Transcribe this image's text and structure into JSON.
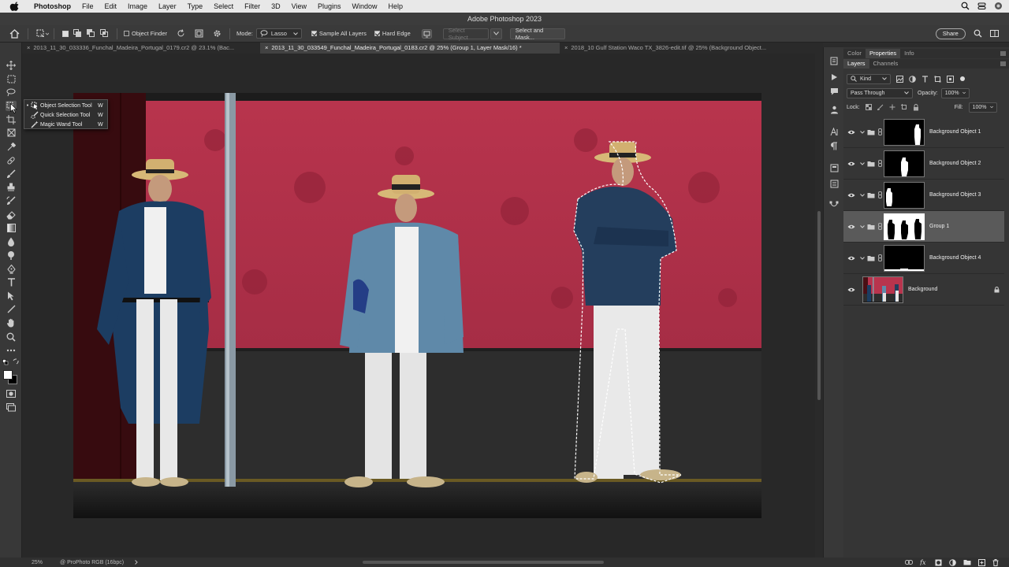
{
  "menubar": {
    "app_name": "Photoshop",
    "items": [
      "File",
      "Edit",
      "Image",
      "Layer",
      "Type",
      "Select",
      "Filter",
      "3D",
      "View",
      "Plugins",
      "Window",
      "Help"
    ]
  },
  "window": {
    "title": "Adobe Photoshop 2023"
  },
  "options_bar": {
    "object_finder_label": "Object Finder",
    "mode_label": "Mode:",
    "mode_value": "Lasso",
    "sample_all_layers_label": "Sample All Layers",
    "sample_all_layers_checked": true,
    "hard_edge_label": "Hard Edge",
    "hard_edge_checked": true,
    "select_subject_label": "Select Subject",
    "select_and_mask_label": "Select and Mask...",
    "share_label": "Share"
  },
  "tabs": [
    {
      "close": "×",
      "label": "2013_11_30_033336_Funchal_Madeira_Portugal_0179.cr2 @ 23.1% (Bac...",
      "active": false
    },
    {
      "close": "×",
      "label": "2013_11_30_033549_Funchal_Madeira_Portugal_0183.cr2 @ 25% (Group 1, Layer Mask/16) *",
      "active": true
    },
    {
      "close": "×",
      "label": "2018_10 Gulf Station Waco TX_3826-edit.tif @ 25% (Background Object...",
      "active": false
    }
  ],
  "tool_flyout": {
    "items": [
      {
        "label": "Object Selection Tool",
        "shortcut": "W",
        "active": true
      },
      {
        "label": "Quick Selection Tool",
        "shortcut": "W",
        "active": false
      },
      {
        "label": "Magic Wand Tool",
        "shortcut": "W",
        "active": false
      }
    ]
  },
  "panels": {
    "top_tabs": [
      "Color",
      "Properties",
      "Info"
    ],
    "top_active": "Properties",
    "layer_tabs": [
      "Layers",
      "Channels"
    ],
    "layer_active": "Layers",
    "filter_kind": "Kind",
    "blend_mode": "Pass Through",
    "opacity_label": "Opacity:",
    "opacity_value": "100%",
    "lock_label": "Lock:",
    "fill_label": "Fill:",
    "fill_value": "100%",
    "layers": [
      {
        "name": "Background Object 1",
        "type": "group",
        "selected": false
      },
      {
        "name": "Background Object 2",
        "type": "group",
        "selected": false
      },
      {
        "name": "Background Object 3",
        "type": "group",
        "selected": false
      },
      {
        "name": "Group 1",
        "type": "group",
        "selected": true
      },
      {
        "name": "Background Object 4",
        "type": "group",
        "selected": false
      },
      {
        "name": "Background",
        "type": "image",
        "selected": false,
        "locked": true
      }
    ]
  },
  "status": {
    "zoom": "25%",
    "profile": "ProPhoto RGB (16bpc)"
  },
  "colors": {
    "wall_red": "#b8344d",
    "wall_dark": "#2e2e2e",
    "ui_dark": "#2b2b2b",
    "selected_layer": "#5a5a5a"
  }
}
